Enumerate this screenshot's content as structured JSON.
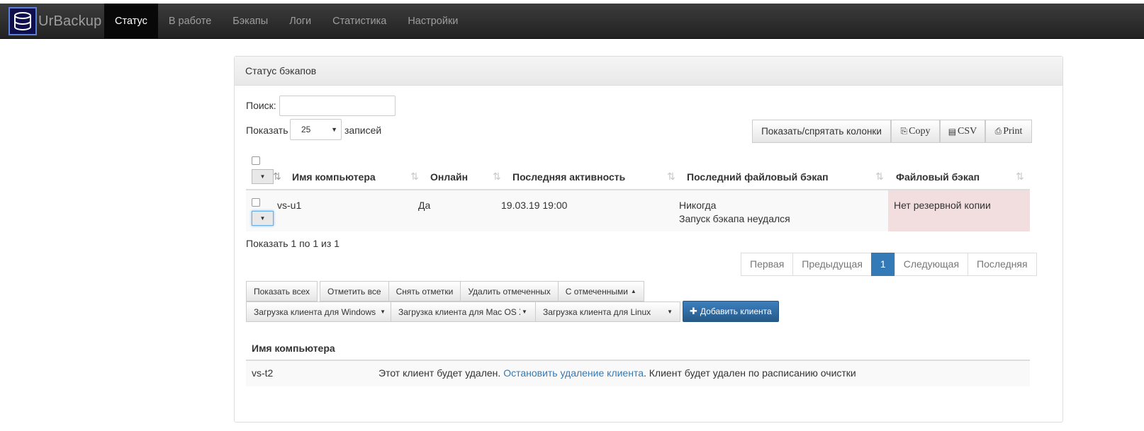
{
  "navbar": {
    "brand": "UrBackup",
    "items": [
      {
        "label": "Статус",
        "active": true
      },
      {
        "label": "В работе",
        "active": false
      },
      {
        "label": "Бэкапы",
        "active": false
      },
      {
        "label": "Логи",
        "active": false
      },
      {
        "label": "Статистика",
        "active": false
      },
      {
        "label": "Настройки",
        "active": false
      }
    ]
  },
  "panel": {
    "title": "Статус бэкапов",
    "search_label": "Поиск:",
    "search_value": "",
    "show_label": "Показать",
    "page_length": "25",
    "entries_label": "записей",
    "buttons": {
      "colvis": "Показать/спрятать колонки",
      "copy": "Copy",
      "csv": "CSV",
      "print": "Print"
    },
    "table": {
      "headers": [
        "Имя компьютера",
        "Онлайн",
        "Последняя активность",
        "Последний файловый бэкап",
        "Файловый бэкап"
      ],
      "rows": [
        {
          "name": "vs-u1",
          "online": "Да",
          "last_seen": "19.03.19 19:00",
          "last_file_backup": "Никогда",
          "last_file_backup_note": "Запуск бэкапа неудался",
          "file_backup_status": "Нет резервной копии"
        }
      ]
    },
    "info": "Показать 1 по 1 из 1",
    "pagination": {
      "first": "Первая",
      "previous": "Предыдущая",
      "current": "1",
      "next": "Следующая",
      "last": "Последняя"
    },
    "actions": {
      "show_all": "Показать всех",
      "select_all": "Отметить все",
      "deselect": "Снять отметки",
      "delete_selected": "Удалить отмеченных",
      "with_selected": "С отмеченными"
    },
    "downloads": {
      "windows": "Загрузка клиента для Windows",
      "mac": "Загрузка клиента для Mac OS X",
      "linux": "Загрузка клиента для Linux",
      "add_client": "Добавить клиента"
    },
    "removed": {
      "header": "Имя компьютера",
      "name": "vs-t2",
      "text_before": "Этот клиент будет удален.",
      "link": "Остановить удаление клиента",
      "text_after": ". Клиент будет удален по расписанию очистки"
    }
  },
  "colors": {
    "navbar": "#222222",
    "primary": "#337ab7",
    "danger_bg": "#f2dede"
  }
}
